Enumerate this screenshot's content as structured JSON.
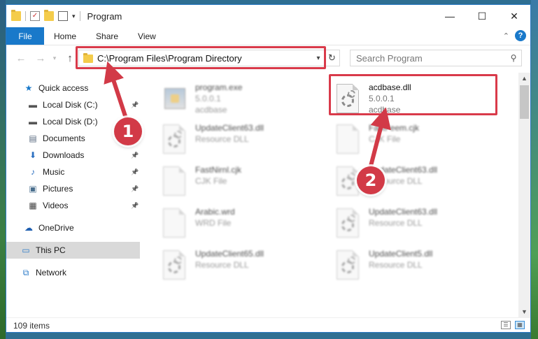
{
  "window": {
    "title": "Program",
    "controls": {
      "minimize": "—",
      "maximize": "☐",
      "close": "✕"
    }
  },
  "ribbon": {
    "tabs": [
      "File",
      "Home",
      "Share",
      "View"
    ]
  },
  "nav": {
    "back": "←",
    "forward": "→",
    "up": "↑",
    "address": "C:\\Program Files\\Program Directory",
    "refresh": "↻",
    "search_placeholder": "Search Program"
  },
  "sidebar": {
    "items": [
      {
        "label": "Quick access",
        "icon": "star-icon",
        "glyph": "★",
        "pinned": false,
        "selected": false
      },
      {
        "label": "Local Disk (C:)",
        "icon": "drive-icon",
        "glyph": "▬",
        "pinned": true,
        "selected": false
      },
      {
        "label": "Local Disk (D:)",
        "icon": "drive-icon",
        "glyph": "▬",
        "pinned": false,
        "selected": false
      },
      {
        "label": "Documents",
        "icon": "documents-icon",
        "glyph": "▤",
        "pinned": true,
        "selected": false
      },
      {
        "label": "Downloads",
        "icon": "downloads-icon",
        "glyph": "⬇",
        "pinned": true,
        "selected": false
      },
      {
        "label": "Music",
        "icon": "music-icon",
        "glyph": "♪",
        "pinned": true,
        "selected": false
      },
      {
        "label": "Pictures",
        "icon": "pictures-icon",
        "glyph": "▣",
        "pinned": true,
        "selected": false
      },
      {
        "label": "Videos",
        "icon": "videos-icon",
        "glyph": "▦",
        "pinned": true,
        "selected": false
      },
      {
        "label": "OneDrive",
        "icon": "cloud-icon",
        "glyph": "☁",
        "pinned": false,
        "selected": false
      },
      {
        "label": "This PC",
        "icon": "computer-icon",
        "glyph": "▭",
        "pinned": false,
        "selected": true
      },
      {
        "label": "Network",
        "icon": "network-icon",
        "glyph": "⧉",
        "pinned": false,
        "selected": false
      }
    ]
  },
  "files": [
    {
      "name": "program.exe",
      "sub1": "5.0.0.1",
      "sub2": "acdbase",
      "type": "exe",
      "blurred": true
    },
    {
      "name": "acdbase.dll",
      "sub1": "5.0.0.1",
      "sub2": "acdbase",
      "type": "dll",
      "blurred": false
    },
    {
      "name": "UpdateClient63.dll",
      "sub1": "Resource DLL",
      "type": "dll",
      "blurred": true
    },
    {
      "name": "FastFeem.cjk",
      "sub1": "CJK File",
      "type": "doc",
      "blurred": true
    },
    {
      "name": "FastNirnl.cjk",
      "sub1": "CJK File",
      "type": "doc",
      "blurred": true
    },
    {
      "name": "UpdateClient63.dll",
      "sub1": "Resource DLL",
      "type": "dll",
      "blurred": true
    },
    {
      "name": "Arabic.wrd",
      "sub1": "WRD File",
      "type": "doc",
      "blurred": true
    },
    {
      "name": "UpdateClient63.dll",
      "sub1": "Resource DLL",
      "type": "dll",
      "blurred": true
    },
    {
      "name": "UpdateClient65.dll",
      "sub1": "Resource DLL",
      "type": "dll",
      "blurred": true
    },
    {
      "name": "UpdateClient5.dll",
      "sub1": "Resource DLL",
      "type": "dll",
      "blurred": true
    }
  ],
  "status": {
    "item_count": "109 items"
  },
  "callouts": [
    "1",
    "2"
  ],
  "colors": {
    "accent": "#1979ca",
    "highlight": "#d93a4a",
    "selected_bg": "#d9d9d9"
  }
}
